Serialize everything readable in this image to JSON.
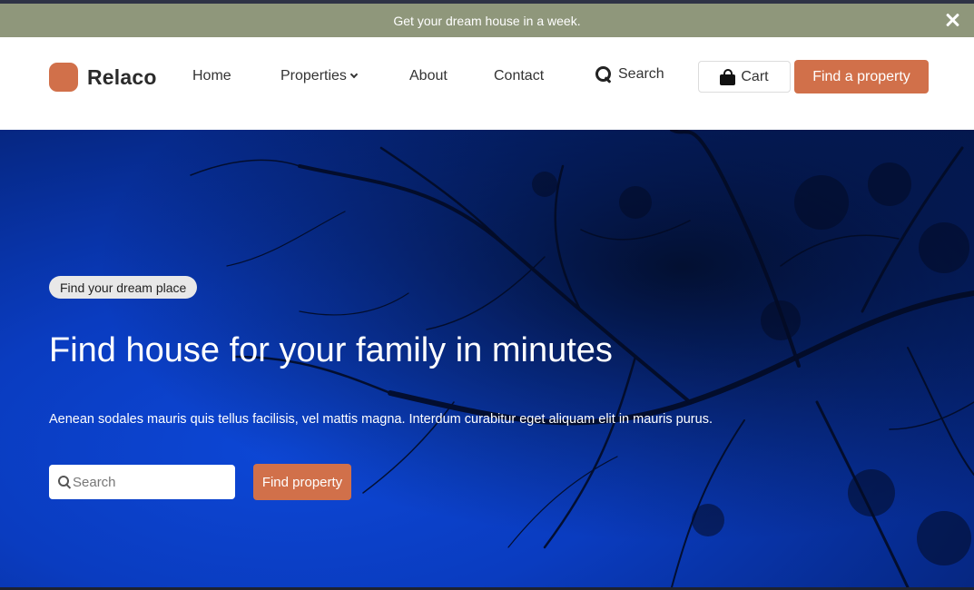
{
  "announcement": {
    "text": "Get your dream house in a week.",
    "close_icon": "close-icon"
  },
  "brand": {
    "name": "Relaco",
    "accent": "#d1704a"
  },
  "nav": {
    "items": [
      {
        "label": "Home"
      },
      {
        "label": "Properties",
        "icon": "chevron-down-icon"
      },
      {
        "label": "About"
      },
      {
        "label": "Contact"
      }
    ],
    "search_label": "Search",
    "cart_label": "Cart",
    "cta_label": "Find a property"
  },
  "hero": {
    "badge": "Find your dream place",
    "title": "Find house for your family in minutes",
    "subtitle": "Aenean sodales mauris quis tellus facilisis, vel mattis magna. Interdum curabitur eget aliquam elit in mauris purus.",
    "search_placeholder": "Search",
    "button_label": "Find property"
  },
  "colors": {
    "announcement_bg": "#8f977b",
    "hero_blue": "#0a3cc0",
    "cta": "#d1704a"
  }
}
